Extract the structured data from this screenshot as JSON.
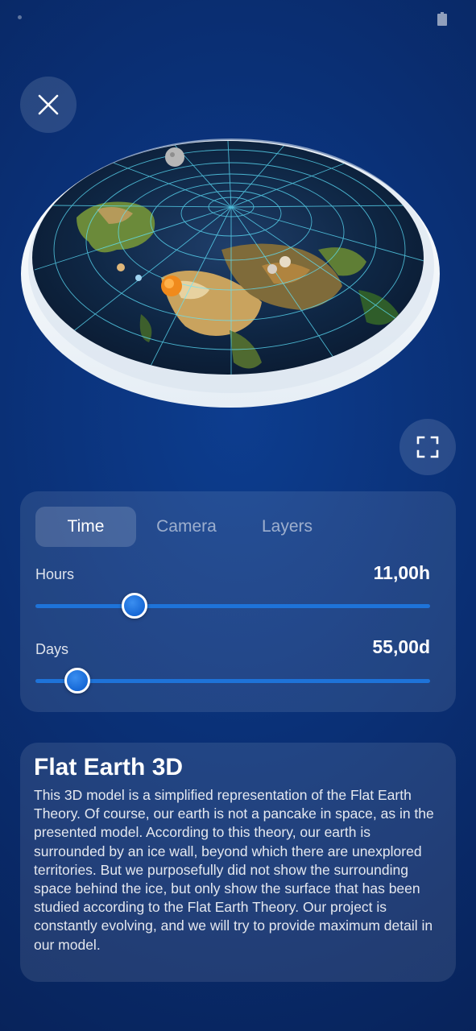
{
  "tabs": [
    {
      "label": "Time",
      "active": true
    },
    {
      "label": "Camera",
      "active": false
    },
    {
      "label": "Layers",
      "active": false
    }
  ],
  "sliders": {
    "hours": {
      "label": "Hours",
      "value_text": "11,00h",
      "fraction": 0.25
    },
    "days": {
      "label": "Days",
      "value_text": "55,00d",
      "fraction": 0.107
    }
  },
  "info": {
    "title": "Flat Earth 3D",
    "body": "This 3D model is a simplified representation of the Flat Earth Theory. Of course, our earth is not a pancake in space, as in the presented model. According to this theory, our earth is surrounded by an ice wall, beyond which there are unexplored territories. But we purposefully did not show the surrounding space behind the ice, but only show the surface that has been studied according to the Flat Earth Theory. Our project is constantly evolving, and we will try to provide maximum detail in our model."
  },
  "icons": {
    "close": "close-icon",
    "expand": "fullscreen-icon",
    "battery": "battery-icon"
  },
  "colors": {
    "background": "#0a2f74",
    "accent": "#1e73d9",
    "grid": "#5fe6ff"
  }
}
